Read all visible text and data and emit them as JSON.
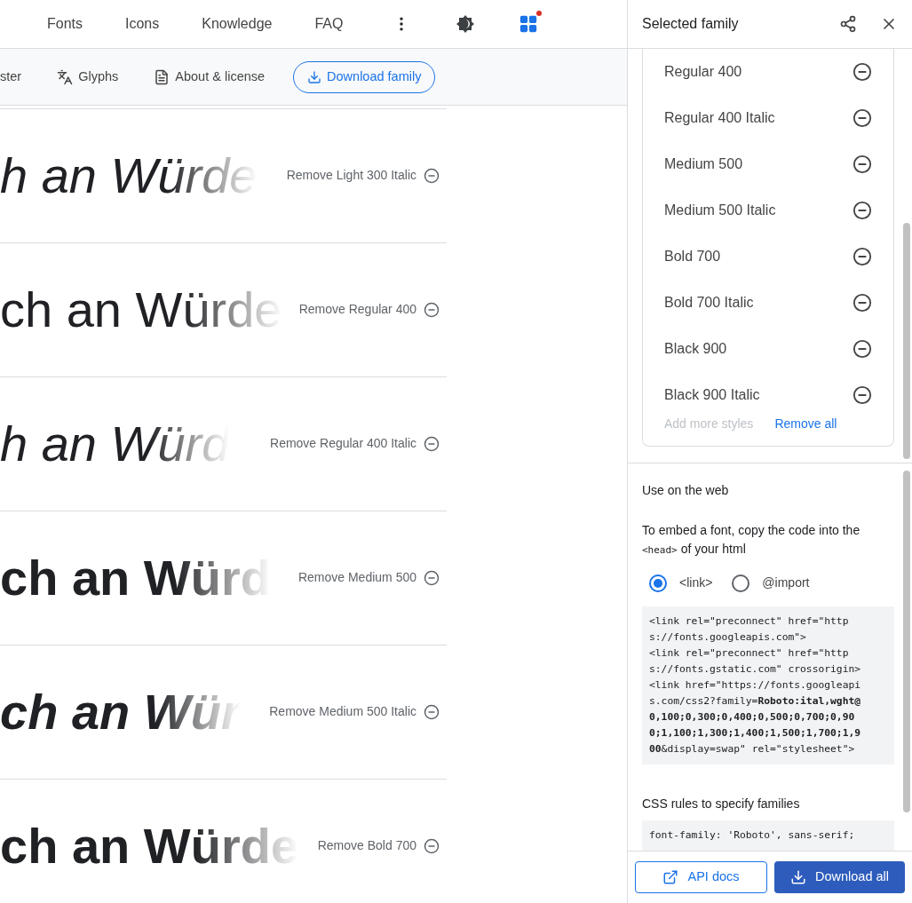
{
  "nav": {
    "links": [
      "Fonts",
      "Icons",
      "Knowledge",
      "FAQ"
    ],
    "selected_badge": true
  },
  "subnav": {
    "tabs": [
      {
        "label": "ster",
        "kind": "text"
      },
      {
        "label": "Glyphs",
        "kind": "glyphs"
      },
      {
        "label": "About & license",
        "kind": "about"
      }
    ],
    "download": "Download family"
  },
  "styles": [
    {
      "sample": "h an Würde",
      "kind": "light-italic",
      "remove": "Remove Light 300 Italic"
    },
    {
      "sample": "ch an Würde",
      "kind": "regular",
      "remove": "Remove Regular 400"
    },
    {
      "sample": "h an Würd",
      "kind": "regular-italic",
      "remove": "Remove Regular 400 Italic"
    },
    {
      "sample": "ch an Würd",
      "kind": "medium",
      "remove": "Remove Medium 500"
    },
    {
      "sample": "ch an Wür",
      "kind": "medium-italic",
      "remove": "Remove Medium 500 Italic"
    },
    {
      "sample": "ch an Würde",
      "kind": "bold",
      "remove": "Remove Bold 700"
    }
  ],
  "panel": {
    "title": "Selected family",
    "selected_styles": [
      "Regular 400",
      "Regular 400 Italic",
      "Medium 500",
      "Medium 500 Italic",
      "Bold 700",
      "Bold 700 Italic",
      "Black 900",
      "Black 900 Italic"
    ],
    "add_more": "Add more styles",
    "remove_all": "Remove all",
    "web": {
      "heading": "Use on the web",
      "intro_code": "<head>",
      "intro_before": "To embed a font, copy the code into the",
      "intro_after": "of your html",
      "options": [
        {
          "label": "<link>",
          "selected": true
        },
        {
          "label": "@import",
          "selected": false
        }
      ],
      "code_lines": [
        "<link rel=\"preconnect\" href=\"http",
        "s://fonts.googleapis.com\">",
        "<link rel=\"preconnect\" href=\"http",
        "s://fonts.gstatic.com\" crossorigin>",
        "<link href=\"https://fonts.googleapi",
        "s.com/css2?family=**Roboto:ital,wght@**",
        "**0,100;0,300;0,400;0,500;0,700;0,90**",
        "**0;1,100;1,300;1,400;1,500;1,700;1,9**",
        "**00**&display=swap\" rel=\"stylesheet\">"
      ],
      "css_heading": "CSS rules to specify families",
      "css_code": "font-family: 'Roboto', sans-serif;"
    },
    "buttons": {
      "api": "API docs",
      "download": "Download all"
    }
  }
}
